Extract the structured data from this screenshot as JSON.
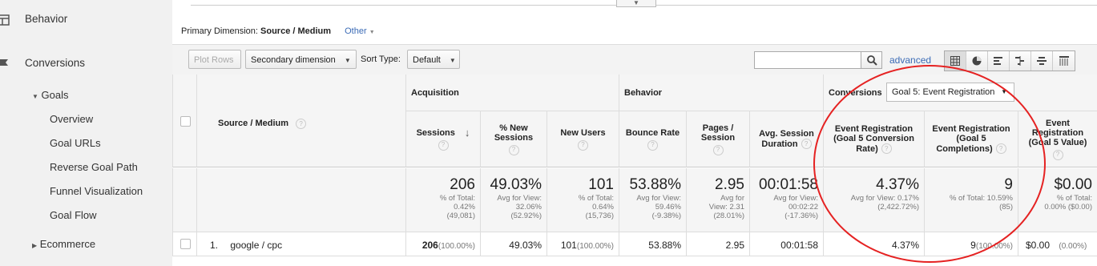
{
  "sidebar": {
    "behavior": "Behavior",
    "conversions": "Conversions",
    "goals": "Goals",
    "goal_items": [
      "Overview",
      "Goal URLs",
      "Reverse Goal Path",
      "Funnel Visualization",
      "Goal Flow"
    ],
    "ecommerce": "Ecommerce"
  },
  "primary_dimension": {
    "label": "Primary Dimension:",
    "value": "Source / Medium",
    "other": "Other"
  },
  "toolbar": {
    "plot_rows": "Plot Rows",
    "secondary_dimension": "Secondary dimension",
    "sort_type_label": "Sort Type:",
    "sort_type_value": "Default",
    "advanced": "advanced"
  },
  "table": {
    "groups": {
      "acquisition": "Acquisition",
      "behavior": "Behavior",
      "conversions": "Conversions",
      "goal_select": "Goal 5: Event Registration"
    },
    "columns": {
      "source_medium": "Source / Medium",
      "sessions": "Sessions",
      "pct_new_sessions": [
        "% New",
        "Sessions"
      ],
      "new_users": "New Users",
      "bounce_rate": "Bounce Rate",
      "pages_session": [
        "Pages /",
        "Session"
      ],
      "avg_session": [
        "Avg. Session",
        "Duration"
      ],
      "conv_rate": [
        "Event Registration",
        "(Goal 5 Conversion",
        "Rate)"
      ],
      "completions": [
        "Event Registration",
        "(Goal 5",
        "Completions)"
      ],
      "value": [
        "Event",
        "Registration",
        "(Goal 5 Value)"
      ]
    },
    "totals": {
      "sessions": {
        "big": "206",
        "l1": "% of Total:",
        "l2": "0.42%",
        "l3": "(49,081)"
      },
      "pct_new": {
        "big": "49.03%",
        "l1": "Avg for View:",
        "l2": "32.06%",
        "l3": "(52.92%)"
      },
      "new_users": {
        "big": "101",
        "l1": "% of Total:",
        "l2": "0.64%",
        "l3": "(15,736)"
      },
      "bounce": {
        "big": "53.88%",
        "l1": "Avg for View:",
        "l2": "59.46%",
        "l3": "(-9.38%)"
      },
      "pages": {
        "big": "2.95",
        "l1": "Avg for",
        "l2": "View: 2.31",
        "l3": "(28.01%)"
      },
      "duration": {
        "big": "00:01:58",
        "l1": "Avg for View:",
        "l2": "00:02:22",
        "l3": "(-17.36%)"
      },
      "conv_rate": {
        "big": "4.37%",
        "l1": "Avg for View: 0.17%",
        "l2": "(2,422.72%)"
      },
      "completions": {
        "big": "9",
        "l1": "% of Total: 10.59%",
        "l2": "(85)"
      },
      "value": {
        "big": "$0.00",
        "l1": "% of Total:",
        "l2": "0.00% ($0.00)"
      }
    },
    "rows": [
      {
        "index": "1.",
        "source": "google / cpc",
        "sessions": "206",
        "sessions_pct": "(100.00%)",
        "pct_new": "49.03%",
        "new_users": "101",
        "new_users_pct": "(100.00%)",
        "bounce": "53.88%",
        "pages": "2.95",
        "duration": "00:01:58",
        "conv_rate": "4.37%",
        "completions": "9",
        "completions_pct": "(100.00%)",
        "value": "$0.00",
        "value_pct": "(0.00%)"
      }
    ]
  },
  "colors": {
    "highlight_circle": "#e52222",
    "link": "#3b6bb6"
  }
}
